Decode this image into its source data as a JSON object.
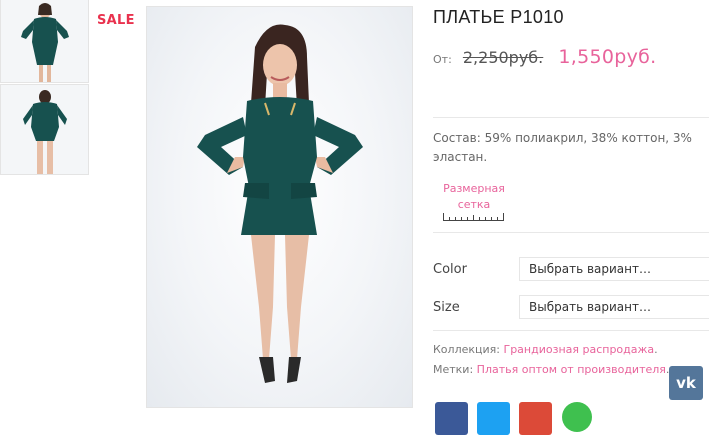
{
  "gallery": {
    "sale_badge": "SALE",
    "thumbnails": [
      "dress-front",
      "dress-back"
    ]
  },
  "product": {
    "title": "ПЛАТЬЕ P1010",
    "price_prefix": "От:",
    "old_price": "2,250руб.",
    "new_price": "1,550руб.",
    "composition": "Состав: 59% полиакрил, 38% коттон, 3% эластан.",
    "size_chart_label": "Размерная сетка"
  },
  "options": {
    "color_label": "Color",
    "color_select": "Выбрать вариант…",
    "size_label": "Size",
    "size_select": "Выбрать вариант…"
  },
  "meta": {
    "collection_label": "Коллекция:",
    "collection_link": "Грандиозная распродажа",
    "tags_label": "Метки:",
    "tags_link": "Платья оптом от производителя",
    "dot": "."
  },
  "social": {
    "vk_label": "vk",
    "colors": {
      "vk": "#54769a",
      "facebook": "#3b5998",
      "twitter": "#1da1f2",
      "google": "#dc4a38",
      "whatsapp": "#3fc04f"
    }
  },
  "colors": {
    "accent": "#e8639b",
    "sale": "#e9324e",
    "dress": "#17514f"
  }
}
